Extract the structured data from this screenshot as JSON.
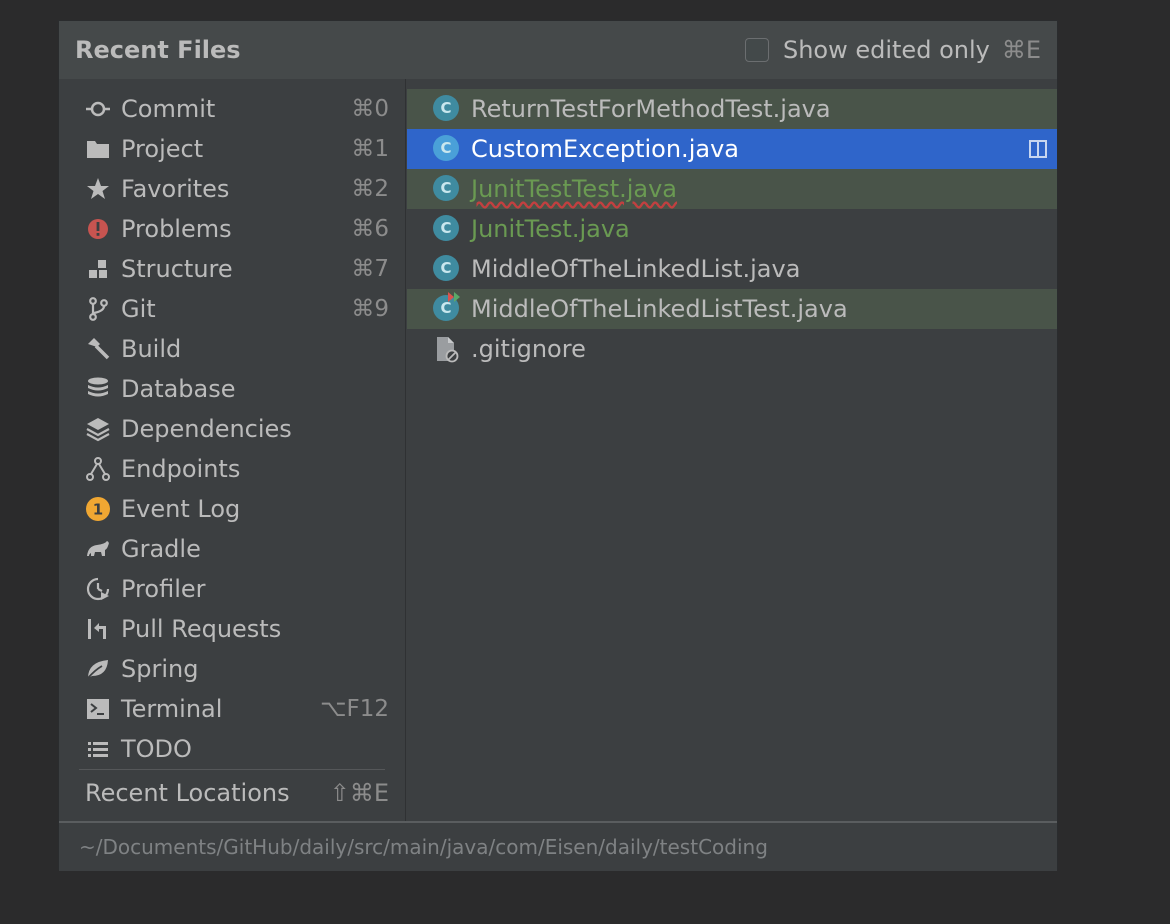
{
  "popup": {
    "title": "Recent Files",
    "show_edited_label": "Show edited only",
    "show_edited_shortcut": "⌘E",
    "show_edited_checked": false
  },
  "sidebar": {
    "items": [
      {
        "label": "Commit",
        "shortcut": "⌘0",
        "icon": "commit-icon"
      },
      {
        "label": "Project",
        "shortcut": "⌘1",
        "icon": "folder-icon"
      },
      {
        "label": "Favorites",
        "shortcut": "⌘2",
        "icon": "star-icon"
      },
      {
        "label": "Problems",
        "shortcut": "⌘6",
        "icon": "problems-icon"
      },
      {
        "label": "Structure",
        "shortcut": "⌘7",
        "icon": "structure-icon"
      },
      {
        "label": "Git",
        "shortcut": "⌘9",
        "icon": "git-branch-icon"
      },
      {
        "label": "Build",
        "shortcut": "",
        "icon": "hammer-icon"
      },
      {
        "label": "Database",
        "shortcut": "",
        "icon": "database-icon"
      },
      {
        "label": "Dependencies",
        "shortcut": "",
        "icon": "layers-icon"
      },
      {
        "label": "Endpoints",
        "shortcut": "",
        "icon": "endpoints-icon"
      },
      {
        "label": "Event Log",
        "shortcut": "",
        "icon": "event-log-icon",
        "badge": "1"
      },
      {
        "label": "Gradle",
        "shortcut": "",
        "icon": "gradle-elephant-icon"
      },
      {
        "label": "Profiler",
        "shortcut": "",
        "icon": "profiler-icon"
      },
      {
        "label": "Pull Requests",
        "shortcut": "",
        "icon": "pull-request-icon"
      },
      {
        "label": "Spring",
        "shortcut": "",
        "icon": "spring-leaf-icon"
      },
      {
        "label": "Terminal",
        "shortcut": "⌥F12",
        "icon": "terminal-icon"
      },
      {
        "label": "TODO",
        "shortcut": "",
        "icon": "todo-list-icon"
      }
    ],
    "recent_locations": {
      "label": "Recent Locations",
      "shortcut": "⇧⌘E"
    }
  },
  "files": [
    {
      "name": "ReturnTestForMethodTest.java",
      "icon": "java-class-icon",
      "state": "highlighted",
      "color": "#bbbbbb"
    },
    {
      "name": "CustomException.java",
      "icon": "java-class-icon",
      "state": "selected",
      "color": "#ffffff"
    },
    {
      "name": "JunitTestTest.java",
      "icon": "java-class-icon",
      "state": "highlighted",
      "color": "#6a9a52"
    },
    {
      "name": "JunitTest.java",
      "icon": "java-class-icon",
      "state": "normal",
      "color": "#6a9a52"
    },
    {
      "name": "MiddleOfTheLinkedList.java",
      "icon": "java-class-icon",
      "state": "normal",
      "color": "#bbbbbb"
    },
    {
      "name": "MiddleOfTheLinkedListTest.java",
      "icon": "java-test-class-icon",
      "state": "highlighted",
      "color": "#bbbbbb"
    },
    {
      "name": ".gitignore",
      "icon": "ignored-file-icon",
      "state": "normal",
      "color": "#bbbbbb"
    }
  ],
  "footer": {
    "path": "~/Documents/GitHub/daily/src/main/java/com/Eisen/daily/testCoding"
  },
  "colors": {
    "background": "#2b2b2c",
    "panel": "#3c3f41",
    "header": "#45494a",
    "selection": "#2f65ca",
    "row_highlight": "#495449",
    "text": "#bbbbbb",
    "muted": "#8c8c8c",
    "java_badge": "#3f8ba0",
    "modified_green": "#6a9a52"
  }
}
